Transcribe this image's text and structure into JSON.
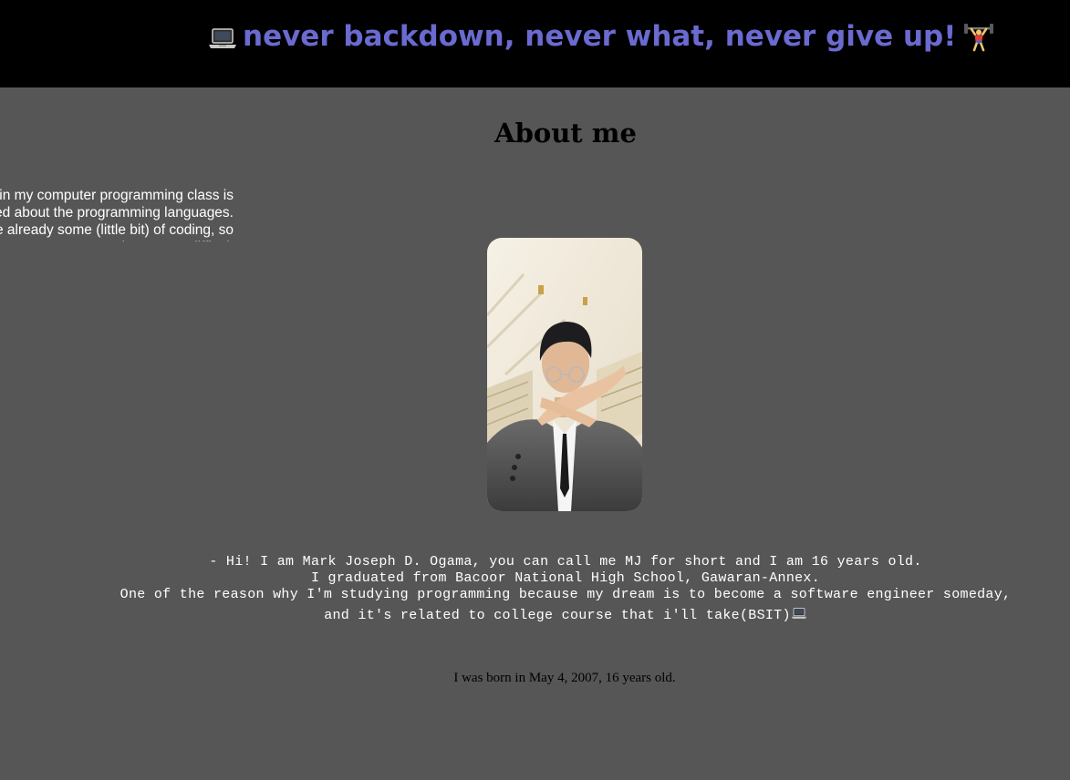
{
  "header": {
    "motto": "never backdown, never what, never give up!",
    "leading_icon": "laptop-icon",
    "trailing_icon": "weightlifter-icon",
    "background": "#000000",
    "text_color": "#6a6ad0"
  },
  "about": {
    "heading": "About me",
    "side_note": "My experience in my computer programming class is that I was confused about the programming languages. However, I have already some (little bit) of coding, so it's not too difficult",
    "photo_alt": "Portrait photo of Mark Joseph D. Ogama in a suit",
    "intro_lines": [
      "- Hi! I am Mark Joseph D. Ogama, you can call me MJ for short and I am 16 years old.",
      "I graduated from Bacoor National High School, Gawaran-Annex.",
      "One of the reason why I'm studying programming because my dream is to become a software engineer someday,",
      "and it's related to college course that i'll take(BSIT)"
    ],
    "intro_trailing_icon": "laptop-icon",
    "birth": "I was born in May 4, 2007, 16 years old."
  },
  "page": {
    "background": "#565656"
  }
}
